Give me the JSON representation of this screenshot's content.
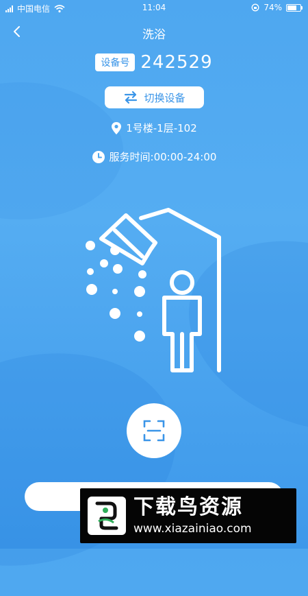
{
  "status_bar": {
    "carrier": "中国电信",
    "time": "11:04",
    "battery_percent_text": "74%",
    "battery_level": 0.74
  },
  "nav": {
    "title": "洗浴",
    "back_icon": "chevron-left-icon"
  },
  "device": {
    "badge_label": "设备号",
    "number": "242529",
    "switch_label": "切换设备",
    "switch_icon": "swap-arrows-icon"
  },
  "location": {
    "icon": "location-pin-icon",
    "text": "1号楼-1层-102"
  },
  "service_time": {
    "icon": "clock-icon",
    "text": "服务时间:00:00-24:00"
  },
  "illustration": {
    "icon": "shower-person-icon"
  },
  "scan": {
    "icon": "scan-frame-icon"
  },
  "watermark": {
    "title": "下载鸟资源",
    "url": "www.xiazainiao.com"
  },
  "colors": {
    "accent": "#3a95e8",
    "background": "#4ea7f0",
    "white": "#ffffff"
  }
}
